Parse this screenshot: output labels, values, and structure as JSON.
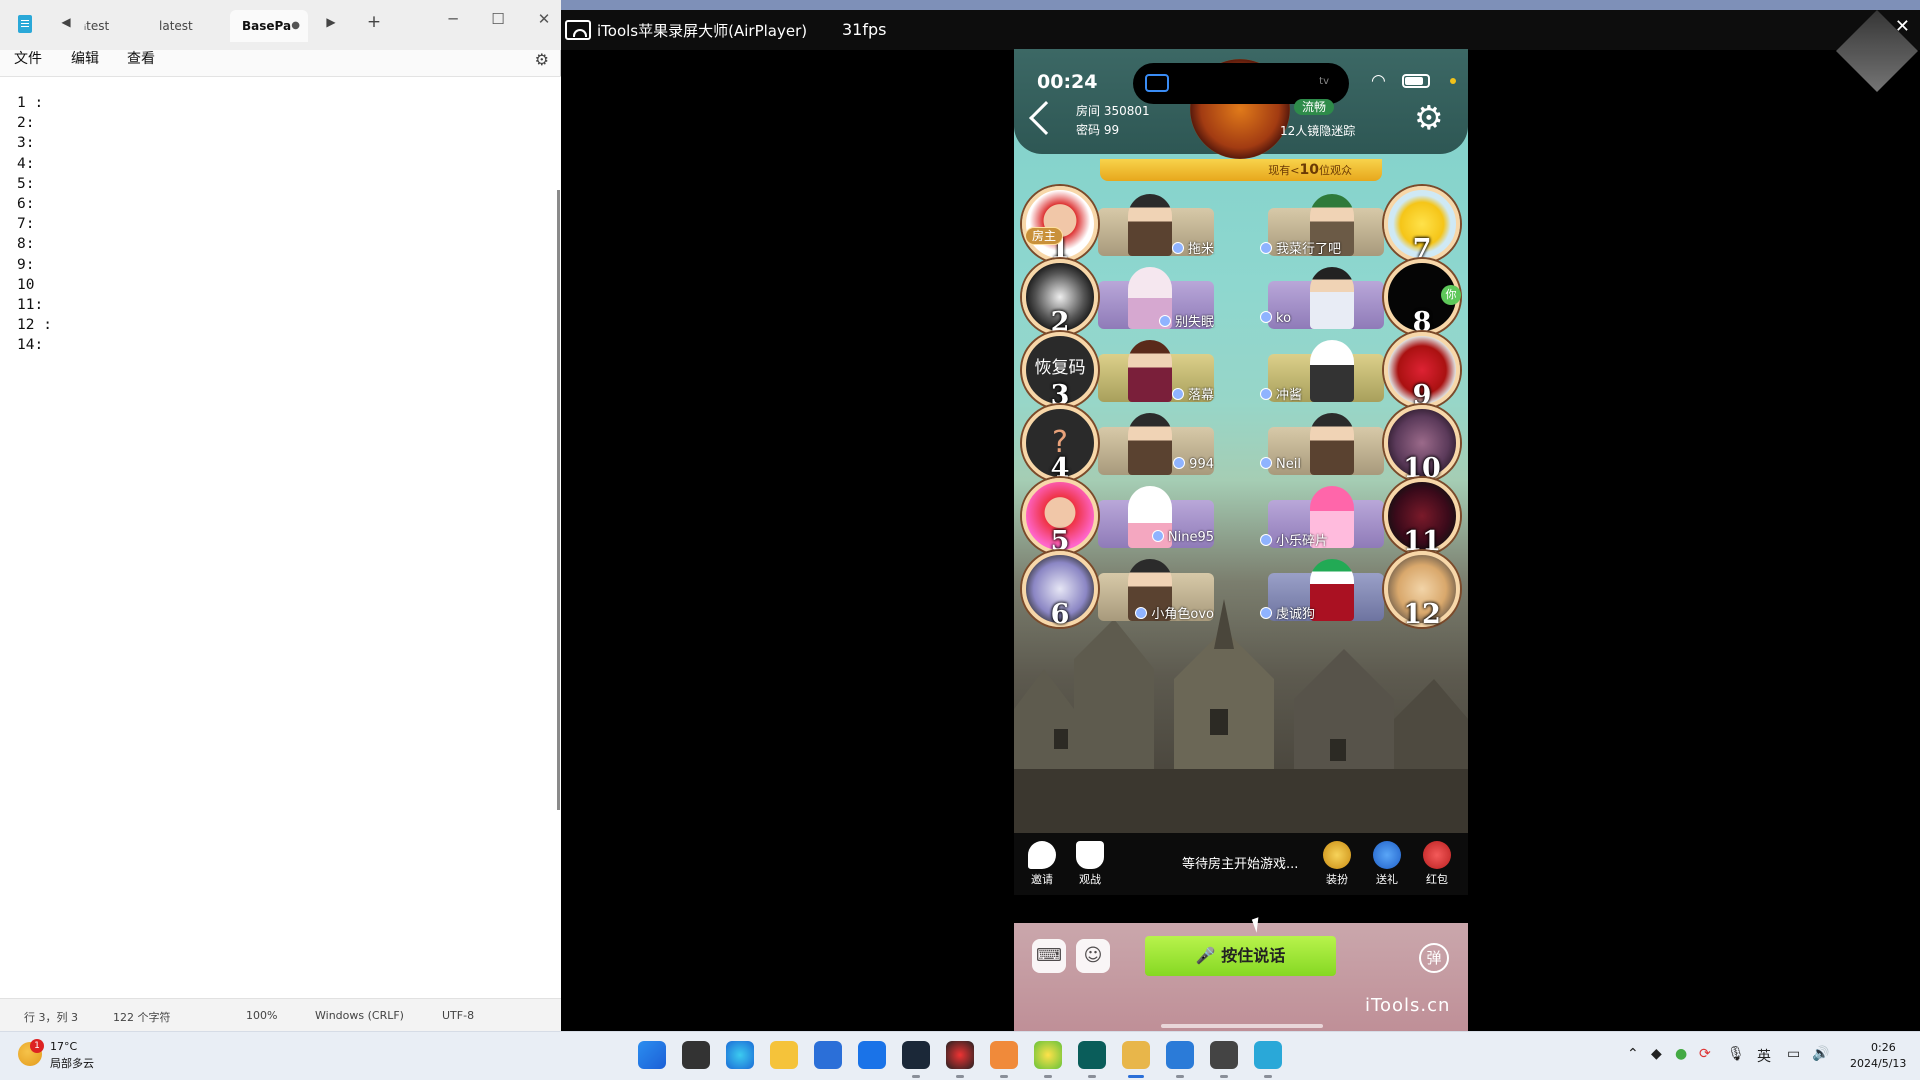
{
  "notepad": {
    "tabs": [
      {
        "label": "ᵢtest"
      },
      {
        "label": "latest"
      },
      {
        "label": "BasePa",
        "active": true,
        "unsaved_dot": "●"
      }
    ],
    "add_tab": "+",
    "menu": [
      "文件",
      "编辑",
      "查看"
    ],
    "lines": [
      "1 :",
      "2:",
      "3:",
      "4:",
      "5:",
      "6:",
      "7:",
      "8:",
      "9:",
      "10",
      "11:",
      "12 :",
      "14:"
    ],
    "status": {
      "position": "行 3，列 3",
      "chars": "122 个字符",
      "zoom": "100%",
      "line_ending": "Windows (CRLF)",
      "encoding": "UTF-8"
    }
  },
  "airplayer": {
    "title": "iTools苹果录屏大师(AirPlayer)",
    "fps": "31fps",
    "close": "✕"
  },
  "phone": {
    "status_time": "00:24",
    "appletv_label": "tv",
    "room": "房间 350801",
    "password": "密码 99",
    "network": "流畅",
    "spectators": "12人镜隐迷踪",
    "viewers": {
      "prefix": "现有<",
      "count": "10",
      "suffix": "位观众"
    },
    "host_badge": "房主",
    "you_badge": "你",
    "seats": [
      {
        "num": "1",
        "name": "拖米"
      },
      {
        "num": "2",
        "name": "别失眠"
      },
      {
        "num": "3",
        "name": "落幕",
        "avatar_text": "恢复码"
      },
      {
        "num": "4",
        "name": "994"
      },
      {
        "num": "5",
        "name": "Nine95"
      },
      {
        "num": "6",
        "name": "小角色ovo"
      },
      {
        "num": "7",
        "name": "我菜行了吧"
      },
      {
        "num": "8",
        "name": "ko"
      },
      {
        "num": "9",
        "name": "冲酱"
      },
      {
        "num": "10",
        "name": "Neil"
      },
      {
        "num": "11",
        "name": "小乐碎片"
      },
      {
        "num": "12",
        "name": "虔诚狗"
      }
    ],
    "bottom": {
      "invite": "邀请",
      "watch": "观战",
      "status": "等待房主开始游戏...",
      "dress": "装扮",
      "gift": "送礼",
      "redpacket": "红包"
    },
    "talk_button": "按住说话",
    "danmu": "弹",
    "watermark": "iTools.cn"
  },
  "taskbar": {
    "weather_temp": "17°C",
    "weather_desc": "局部多云",
    "weather_badge": "1",
    "ime": "英",
    "time": "0:26",
    "date": "2024/5/13"
  },
  "colors": {
    "talk_green": "#9be33a",
    "game_teal": "#8ed7cf",
    "taskbar": "#e9eef5"
  }
}
